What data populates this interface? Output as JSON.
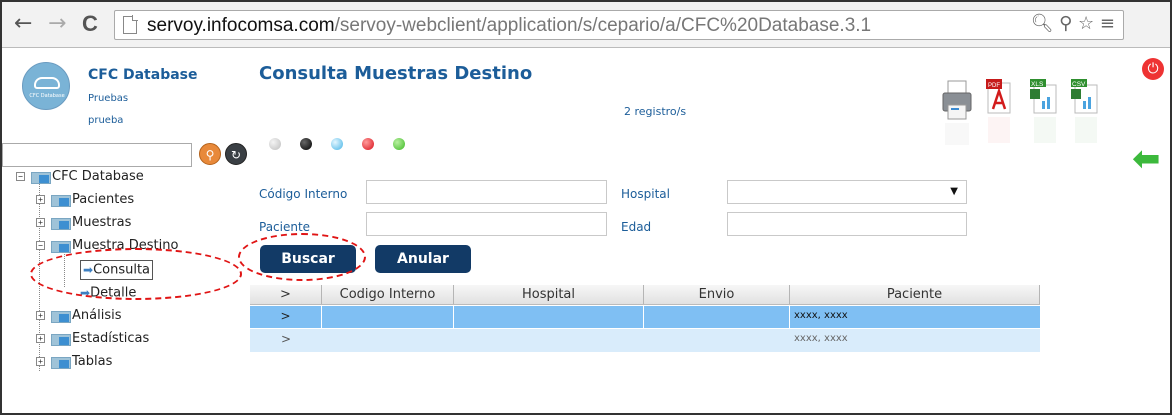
{
  "browser": {
    "back": "←",
    "forward": "→",
    "reload": "C",
    "url_host": "servoy.infocomsa.com",
    "url_path": "/servoy-webclient/application/s/cepario/a/CFC%20Database.3.1",
    "icons": "🔍︎ ⚲ ☆ ≡"
  },
  "sidebar": {
    "logo_text": "CFC Database",
    "app_title": "CFC Database",
    "sub1": "Pruebas",
    "sub2": "prueba",
    "tree": {
      "root": "CFC Database",
      "pacientes": "Pacientes",
      "muestras": "Muestras",
      "muestra_destino": "Muestra Destino",
      "consulta": "Consulta",
      "detalle": "Detalle",
      "analisis": "Análisis",
      "estadisticas": "Estadísticas",
      "tablas": "Tablas"
    }
  },
  "main": {
    "title": "Consulta Muestras Destino",
    "record_count": "2 registro/s",
    "export_icons": [
      "print-icon",
      "pdf-icon",
      "xls-icon",
      "csv-icon"
    ],
    "xls_label": "XLS",
    "csv_label": "CSV",
    "form": {
      "codigo_label": "Código Interno",
      "hospital_label": "Hospital",
      "paciente_label": "Paciente",
      "edad_label": "Edad",
      "codigo_value": "",
      "paciente_value": "",
      "edad_value": "",
      "hospital_value": ""
    },
    "buttons": {
      "search": "Buscar",
      "cancel": "Anular"
    },
    "table": {
      "headers": [
        ">",
        "Codigo Interno",
        "Hospital",
        "Envio",
        "Paciente"
      ],
      "rows": [
        [
          ">",
          "",
          "",
          "",
          "xxxx, xxxx"
        ],
        [
          ">",
          "",
          "",
          "",
          "xxxx, xxxx"
        ]
      ]
    }
  },
  "colors": {
    "accent": "#1c5d99",
    "button": "#123a66",
    "selected_row": "#7fbff3",
    "alt_row": "#d9ecfb",
    "annotation": "#e01414"
  }
}
